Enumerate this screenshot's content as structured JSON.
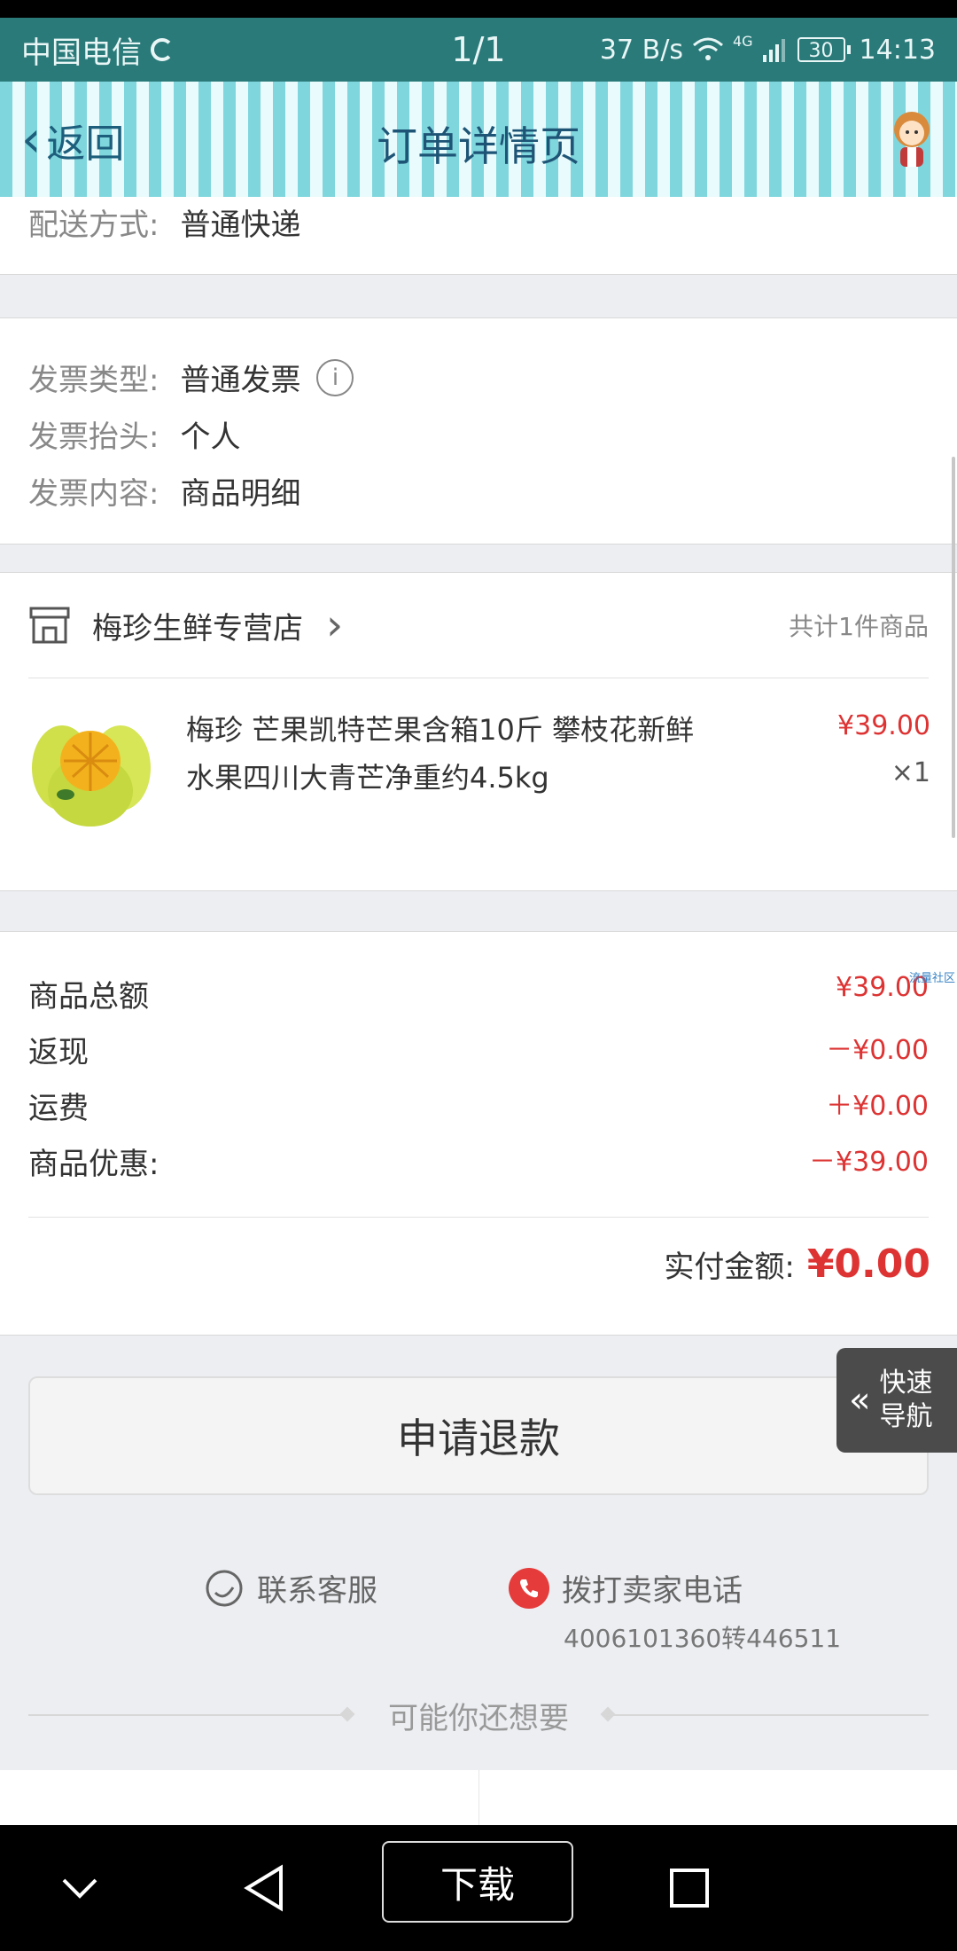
{
  "status_bar": {
    "carrier": "中国电信",
    "page_indicator": "1/1",
    "net_speed": "37 B/s",
    "signal_type": "4G",
    "battery": "30",
    "time": "14:13"
  },
  "header": {
    "back_label": "返回",
    "title": "订单详情页"
  },
  "delivery": {
    "label": "配送方式:",
    "value": "普通快递"
  },
  "invoice": {
    "type_label": "发票类型:",
    "type_value": "普通发票",
    "title_label": "发票抬头:",
    "title_value": "个人",
    "content_label": "发票内容:",
    "content_value": "商品明细"
  },
  "shop": {
    "name": "梅珍生鲜专营店",
    "count": "共计1件商品"
  },
  "product": {
    "title": "梅珍 芒果凯特芒果含箱10斤 攀枝花新鲜水果四川大青芒净重约4.5kg",
    "price": "¥39.00",
    "qty": "×1"
  },
  "summary": {
    "rows": [
      {
        "label": "商品总额",
        "amount": "¥39.00"
      },
      {
        "label": "返现",
        "amount": "－¥0.00"
      },
      {
        "label": "运费",
        "amount": "＋¥0.00"
      },
      {
        "label": "商品优惠:",
        "amount": "－¥39.00"
      }
    ],
    "paid_label": "实付金额:",
    "paid_value": "¥0.00"
  },
  "actions": {
    "refund_label": "申请退款",
    "quick_nav_label": "快速导航",
    "contact_label": "联系客服",
    "call_label": "拨打卖家电话",
    "phone": "4006101360转446511",
    "maybe_label": "可能你还想要"
  },
  "watermark": "流量社区",
  "navbar": {
    "download_label": "下载"
  },
  "colors": {
    "status_bar": "#2b7a7a",
    "accent_red": "#d33333",
    "title_blue": "#1e5576"
  }
}
